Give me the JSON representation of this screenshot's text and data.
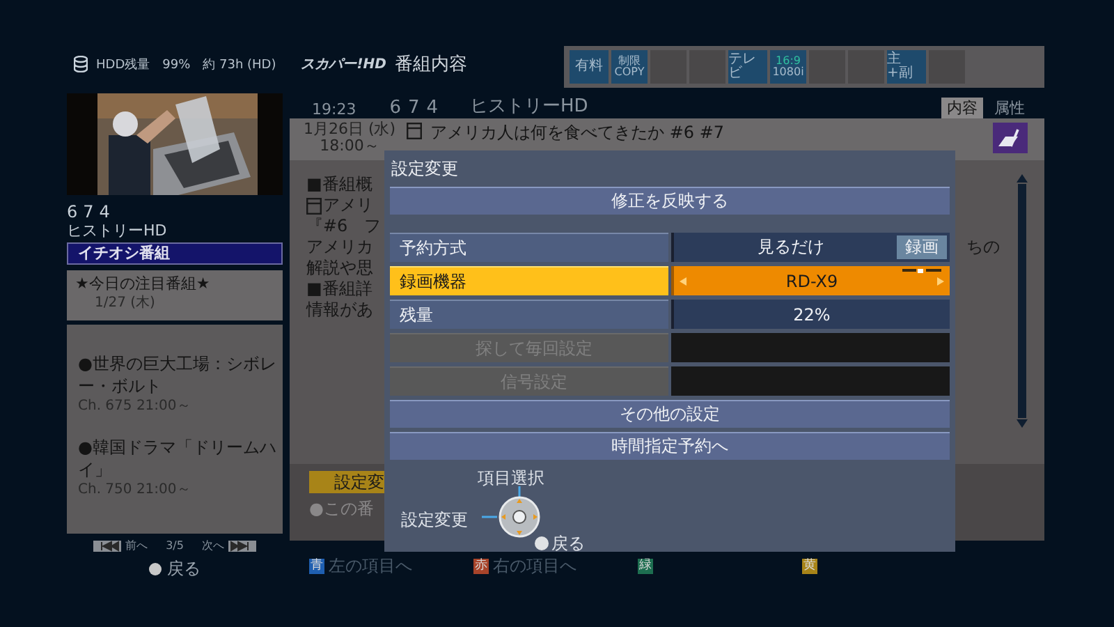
{
  "status": {
    "storage": "HDD残量　99%　約 73h (HD)",
    "logo": "スカパー!HD",
    "title": "番組内容"
  },
  "badges": [
    {
      "kind": "text",
      "label": "有料"
    },
    {
      "kind": "stack",
      "top": "制限",
      "bottom": "COPY",
      "accent": false
    },
    {
      "kind": "empty"
    },
    {
      "kind": "empty"
    },
    {
      "kind": "text",
      "label": "テレビ"
    },
    {
      "kind": "stack",
      "top": "16:9",
      "bottom": "1080i",
      "accent": true
    },
    {
      "kind": "empty"
    },
    {
      "kind": "empty"
    },
    {
      "kind": "text",
      "label": "主+副"
    },
    {
      "kind": "empty"
    }
  ],
  "sidebar": {
    "channel_number": "674",
    "channel_name": "ヒストリーHD",
    "section": "イチオシ番組",
    "featured": {
      "title": "★今日の注目番組★",
      "date": "1/27 (木)"
    },
    "picks": [
      {
        "title": "●世界の巨大工場：シボレー・ボルト",
        "info": "Ch. 675 21:00～"
      },
      {
        "title": "●韓国ドラマ「ドリームハイ」",
        "info": "Ch. 750 21:00～"
      }
    ],
    "pager": {
      "prev": "前へ",
      "page": "3/5",
      "next": "次へ"
    },
    "back": "戻る"
  },
  "main": {
    "time": "19:23",
    "channel_number": "674",
    "channel_name": "ヒストリーHD",
    "tabs": [
      {
        "label": "内容",
        "selected": true
      },
      {
        "label": "属性",
        "selected": false
      }
    ],
    "program": {
      "date": "1月26日 (水)",
      "time": "18:00～",
      "title": "アメリカ人は何を食べてきたか #6 #7"
    },
    "body": [
      {
        "text": "■番組概",
        "icon": false
      },
      {
        "text": "アメリ",
        "icon": true
      },
      {
        "text": "『#6　フ",
        "icon": false
      },
      {
        "text": "アメリカ",
        "icon": false,
        "tail": "ちの"
      },
      {
        "text": "解説や思",
        "icon": false
      },
      {
        "text": "■番組詳",
        "icon": false
      },
      {
        "text": "情報があ",
        "icon": false
      }
    ],
    "action": "設定変",
    "note": "●この番"
  },
  "footer": [
    {
      "key": "青",
      "label": "左の項目へ",
      "color": "#1f5fb0"
    },
    {
      "key": "赤",
      "label": "右の項目へ",
      "color": "#a8442a"
    },
    {
      "key": "緑",
      "color": "#1d6e50"
    },
    {
      "key": "黄",
      "color": "#a88418"
    }
  ],
  "dialog": {
    "title": "設定変更",
    "apply": "修正を反映する",
    "rows": [
      {
        "kind": "choice",
        "label": "予約方式",
        "value": "見るだけ",
        "tag": "録画",
        "selected": false,
        "disabled": false
      },
      {
        "kind": "spinner",
        "label": "録画機器",
        "value": "RD-X9",
        "selected": true,
        "disabled": false
      },
      {
        "kind": "value",
        "label": "残量",
        "value": "22%",
        "selected": false,
        "disabled": false
      },
      {
        "kind": "value",
        "label": "探して毎回設定",
        "selected": false,
        "disabled": true
      },
      {
        "kind": "value",
        "label": "信号設定",
        "selected": false,
        "disabled": true
      }
    ],
    "buttons": [
      "その他の設定",
      "時間指定予約へ"
    ],
    "hints": {
      "select": "項目選択",
      "change": "設定変更",
      "back": "戻る"
    }
  }
}
